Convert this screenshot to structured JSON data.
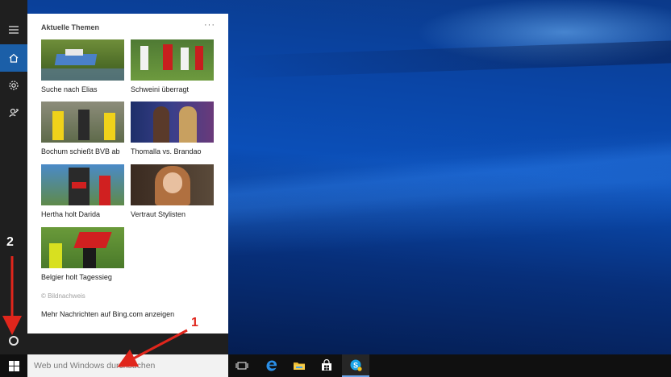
{
  "panel": {
    "header": "Aktuelle Themen",
    "more": "···",
    "tiles": [
      {
        "caption": "Suche nach Elias"
      },
      {
        "caption": "Schweini überragt"
      },
      {
        "caption": "Bochum schießt BVB ab"
      },
      {
        "caption": "Thomalla vs. Brandao"
      },
      {
        "caption": "Hertha holt Darida"
      },
      {
        "caption": "Vertraut Stylisten"
      },
      {
        "caption": "Belgier holt Tagessieg"
      }
    ],
    "credit": "© Bildnachweis",
    "more_news": "Mehr Nachrichten auf Bing.com anzeigen"
  },
  "rail": {
    "icons": [
      "hamburger-icon",
      "home-icon",
      "gear-icon",
      "feedback-icon",
      "cortana-circle-icon"
    ]
  },
  "taskbar": {
    "search_placeholder": "Web und Windows durchsuchen",
    "icons": [
      "windows-logo-icon",
      "task-view-icon",
      "edge-icon",
      "file-explorer-icon",
      "store-icon",
      "skype-icon"
    ]
  },
  "annotations": {
    "one": "1",
    "two": "2"
  },
  "colors": {
    "accent": "#1b5fa8",
    "annotation_red": "#e0261c",
    "rail_bg": "#1f1f1f",
    "taskbar_bg": "#101010"
  }
}
